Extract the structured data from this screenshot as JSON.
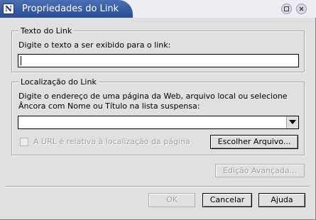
{
  "window": {
    "title": "Propriedades do Link",
    "app_icon_glyph": "N",
    "buttons": {
      "minimize_icon": "minimize-icon",
      "close_icon": "close-icon"
    }
  },
  "link_text_group": {
    "title": "Texto do Link",
    "prompt": "Digite o texto a ser exibido para o link:",
    "value": ""
  },
  "link_location_group": {
    "title": "Localização do Link",
    "prompt_line1": "Digite o endereço de uma página da Web, arquivo local ou selecione",
    "prompt_line2": "Âncora com Nome ou Título na lista suspensa:",
    "url_value": "",
    "relative_url_label": "A URL é relativa à localização da página",
    "relative_url_checked": false,
    "choose_file_label": "Escolher Arquivo..."
  },
  "advanced_edit_label": "Edição Avançada...",
  "footer": {
    "ok_label": "OK",
    "cancel_label": "Cancelar",
    "help_label": "Ajuda"
  },
  "colors": {
    "titlebar_accent": "#2a4d96",
    "dialog_background": "#e0e0e0",
    "disabled_text": "#a0a0a0"
  }
}
